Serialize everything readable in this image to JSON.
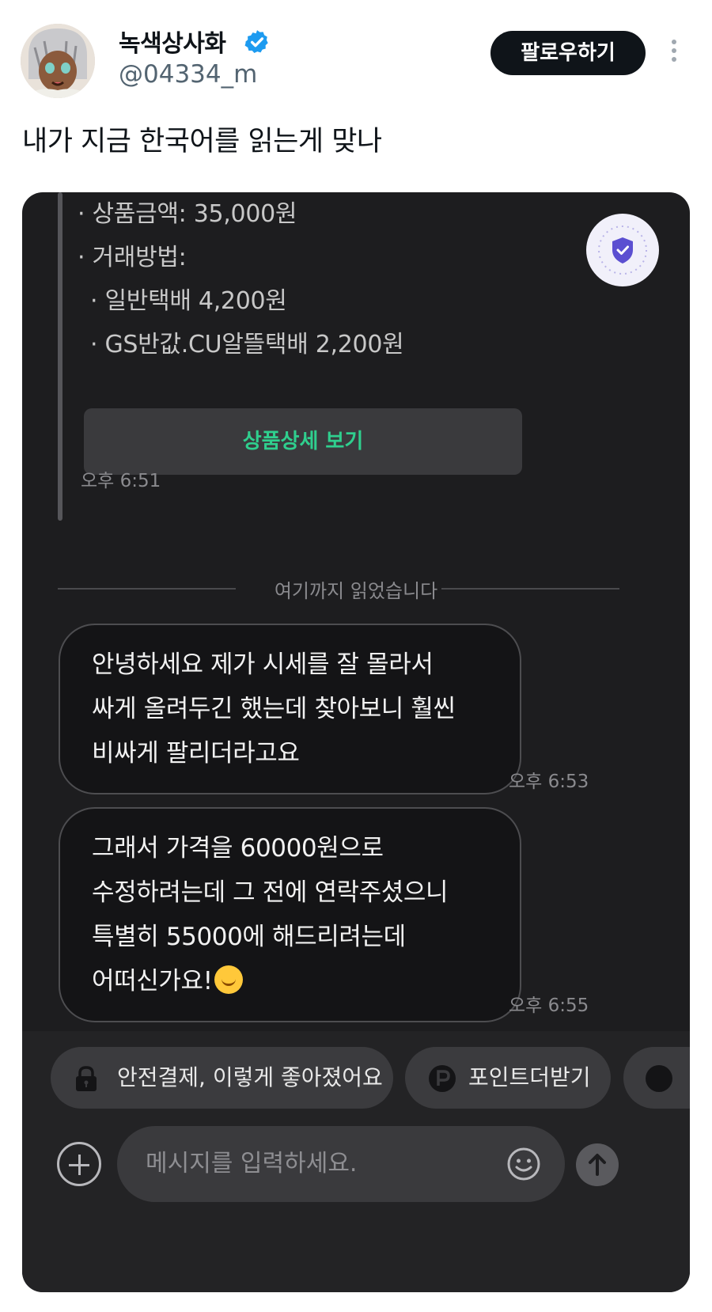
{
  "tweet": {
    "display_name": "녹색상사화",
    "handle": "@04334_m",
    "follow_label": "팔로우하기",
    "text": "내가 지금 한국어를 읽는게 맞나"
  },
  "chat": {
    "product_info": [
      "· 상품금액: 35,000원",
      "· 거래방법:",
      "· 일반택배 4,200원",
      "· GS반값.CU알뜰택배 2,200원"
    ],
    "detail_button": "상품상세 보기",
    "product_time": "오후 6:51",
    "read_divider": "여기까지 읽었습니다",
    "messages": [
      {
        "lines": [
          "안녕하세요 제가 시세를 잘 몰라서",
          "싸게 올려두긴 했는데 찾아보니 훨씬",
          "비싸게 팔리더라고요"
        ],
        "time": "오후 6:53"
      },
      {
        "lines": [
          "그래서 가격을 60000원으로",
          "수정하려는데 그 전에 연락주셨으니",
          "특별히 55000에 해드리려는데",
          "어떠신가요!"
        ],
        "time": "오후 6:55"
      }
    ],
    "chips": [
      "안전결제, 이렇게 좋아졌어요",
      "포인트더받기"
    ],
    "input_placeholder": "메시지를 입력하세요."
  },
  "colors": {
    "verified": "#1d9bf0",
    "chat_bg": "#1d1d1f",
    "accent_green": "#2fcf8e",
    "shield_purple": "#5b4fd1"
  },
  "icons": [
    "verified-badge-icon",
    "more-icon",
    "shield-icon",
    "lock-icon",
    "point-icon",
    "plus-icon",
    "emoji-icon",
    "send-arrow-icon"
  ]
}
